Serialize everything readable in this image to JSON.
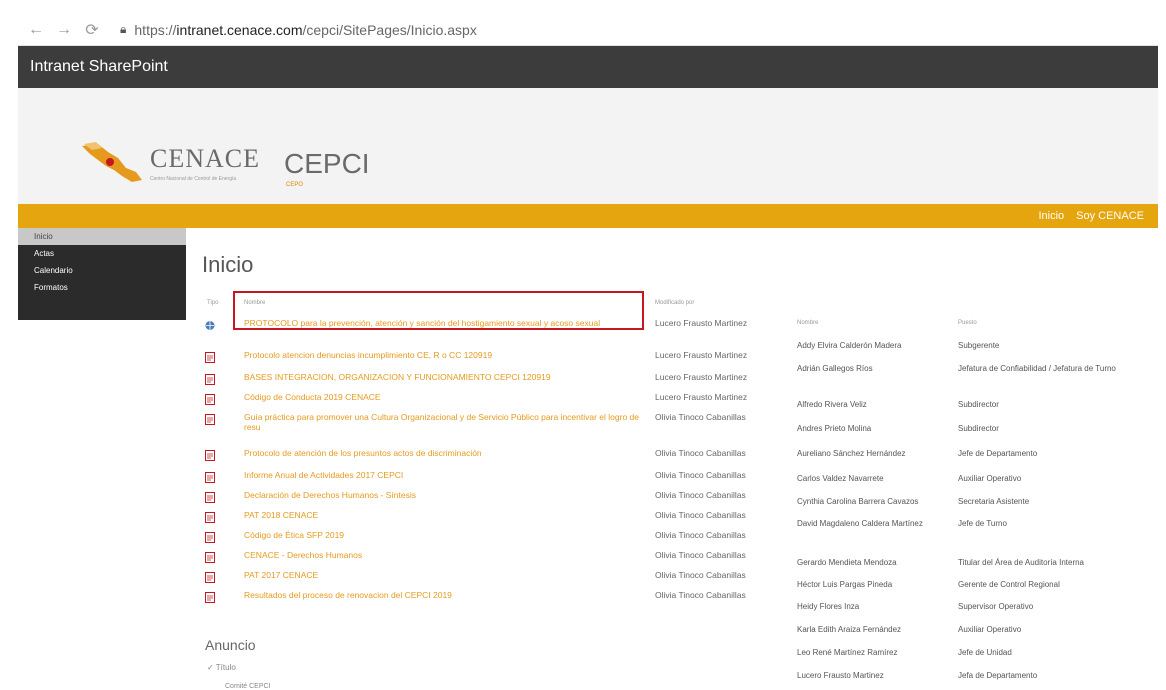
{
  "browser": {
    "url_prefix": "https://",
    "url_domain": "intranet.cenace.com",
    "url_path": "/cepci/SitePages/Inicio.aspx"
  },
  "suite": {
    "title": "Intranet SharePoint"
  },
  "site": {
    "logo_text": "CENACE",
    "logo_subtitle": "Centro Nacional de Control de Energía",
    "title": "CEPCI",
    "subtitle": "CEPO"
  },
  "topnav": {
    "items": [
      "Inicio",
      "Soy CENACE"
    ]
  },
  "leftnav": {
    "items": [
      "Inicio",
      "Actas",
      "Calendario",
      "Formatos"
    ]
  },
  "page": {
    "title": "Inicio"
  },
  "documents": {
    "headers": {
      "type": "Tipo",
      "name": "Nombre",
      "modified_by": "Modificado por"
    },
    "rows": [
      {
        "name": "PROTOCOLO para la prevención, atención y sanción del hostigamiento sexual y acoso sexual",
        "modified_by": "Lucero Frausto Martinez",
        "icon": "globe-icon"
      },
      {
        "name": "Protocolo atencion denuncias incumplimiento CE, R o CC 120919",
        "modified_by": "Lucero Frausto Martinez",
        "icon": "document-icon"
      },
      {
        "name": "BASES INTEGRACION, ORGANIZACION Y FUNCIONAMIENTO CEPCI 120919",
        "modified_by": "Lucero Frausto Martinez",
        "icon": "document-icon"
      },
      {
        "name": "Código de Conducta 2019 CENACE",
        "modified_by": "Lucero Frausto Martinez",
        "icon": "document-icon"
      },
      {
        "name": "Guía práctica para promover una Cultura Organizacional y de Servicio Público para incentivar el logro de resu",
        "modified_by": "Olivia Tinoco Cabanillas",
        "icon": "document-icon"
      },
      {
        "name": "Protocolo de atención de los presuntos actos de discriminación",
        "modified_by": "Olivia Tinoco Cabanillas",
        "icon": "document-icon"
      },
      {
        "name": "Informe Anual de Actividades 2017 CEPCI",
        "modified_by": "Olivia Tinoco Cabanillas",
        "icon": "document-icon"
      },
      {
        "name": "Declaración de Derechos Humanos - Síntesis",
        "modified_by": "Olivia Tinoco Cabanillas",
        "icon": "document-icon"
      },
      {
        "name": "PAT 2018 CENACE",
        "modified_by": "Olivia Tinoco Cabanillas",
        "icon": "document-icon"
      },
      {
        "name": "Código de Ética SFP 2019",
        "modified_by": "Olivia Tinoco Cabanillas",
        "icon": "document-icon"
      },
      {
        "name": "CENACE - Derechos Humanos",
        "modified_by": "Olivia Tinoco Cabanillas",
        "icon": "document-icon"
      },
      {
        "name": "PAT 2017 CENACE",
        "modified_by": "Olivia Tinoco Cabanillas",
        "icon": "document-icon"
      },
      {
        "name": "Resultados del proceso de renovacion del CEPCI 2019",
        "modified_by": "Olivia Tinoco Cabanillas",
        "icon": "document-icon"
      }
    ]
  },
  "people": {
    "headers": {
      "name": "Nombre",
      "role": "Puesto"
    },
    "rows": [
      {
        "name": "Addy Elvira Calderón Madera",
        "role": "Subgerente"
      },
      {
        "name": "Adrián Gallegos Ríos",
        "role": "Jefatura de Confiabilidad / Jefatura de Turno"
      },
      {
        "name": "Alfredo Rivera Veliz",
        "role": "Subdirector"
      },
      {
        "name": "Andres Prieto Molina",
        "role": "Subdirector"
      },
      {
        "name": "Aureliano Sánchez Hernández",
        "role": "Jefe de Departamento"
      },
      {
        "name": "Carlos Valdez Navarrete",
        "role": "Auxiliar Operativo"
      },
      {
        "name": "Cynthia Carolina Barrera Cavazos",
        "role": "Secretaria Asistente"
      },
      {
        "name": "David Magdaleno Caldera Martínez",
        "role": "Jefe de Turno"
      },
      {
        "name": "Gerardo Mendieta Mendoza",
        "role": "Titular del Área de Auditoría Interna"
      },
      {
        "name": "Héctor Luis Pargas Pineda",
        "role": "Gerente de Control Regional"
      },
      {
        "name": "Heidy Flores Inza",
        "role": "Supervisor Operativo"
      },
      {
        "name": "Karla Edith Araiza Fernández",
        "role": "Auxiliar Operativo"
      },
      {
        "name": "Leo René Martínez Ramírez",
        "role": "Jefe de Unidad"
      },
      {
        "name": "Lucero Frausto Martinez",
        "role": "Jefa de Departamento"
      }
    ]
  },
  "announcements": {
    "title": "Anuncio",
    "header": "Título",
    "first_row": "Comité CEPCI"
  }
}
